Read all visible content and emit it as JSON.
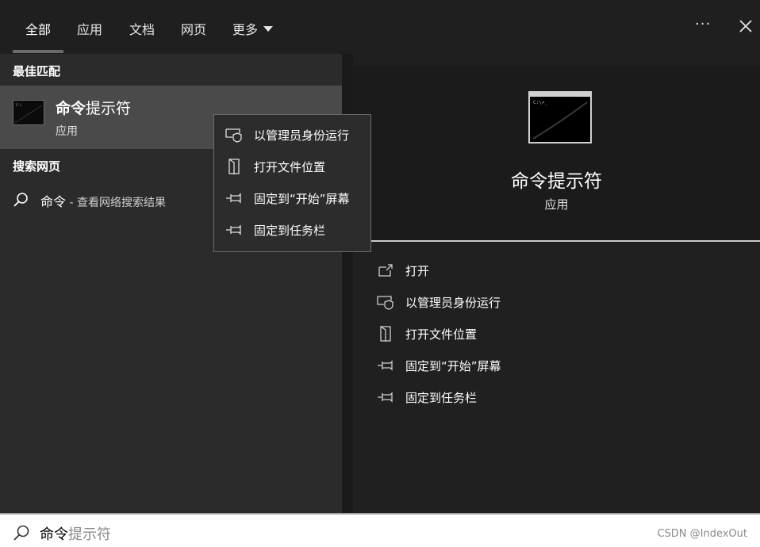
{
  "tabs": [
    {
      "label": "全部"
    },
    {
      "label": "应用"
    },
    {
      "label": "文档"
    },
    {
      "label": "网页"
    },
    {
      "label": "更多"
    }
  ],
  "left": {
    "best_match_title": "最佳匹配",
    "best_match": {
      "name_bold": "命令",
      "name_rest": "提示符",
      "type": "应用"
    },
    "web_title": "搜索网页",
    "web_item": {
      "query": "命令",
      "suffix": " - 查看网络搜索结果"
    }
  },
  "context_menu": [
    {
      "label": "以管理员身份运行",
      "icon": "shield-icon"
    },
    {
      "label": "打开文件位置",
      "icon": "folder-icon"
    },
    {
      "label": "固定到“开始”屏幕",
      "icon": "pin-icon"
    },
    {
      "label": "固定到任务栏",
      "icon": "pin-icon"
    }
  ],
  "right": {
    "title": "命令提示符",
    "type": "应用",
    "actions": [
      {
        "label": "打开",
        "icon": "open-icon"
      },
      {
        "label": "以管理员身份运行",
        "icon": "shield-icon"
      },
      {
        "label": "打开文件位置",
        "icon": "folder-icon"
      },
      {
        "label": "固定到“开始”屏幕",
        "icon": "pin-icon"
      },
      {
        "label": "固定到任务栏",
        "icon": "pin-icon"
      }
    ]
  },
  "search": {
    "typed": "命令",
    "suggestion": "提示符"
  },
  "watermark": "CSDN @IndexOut"
}
